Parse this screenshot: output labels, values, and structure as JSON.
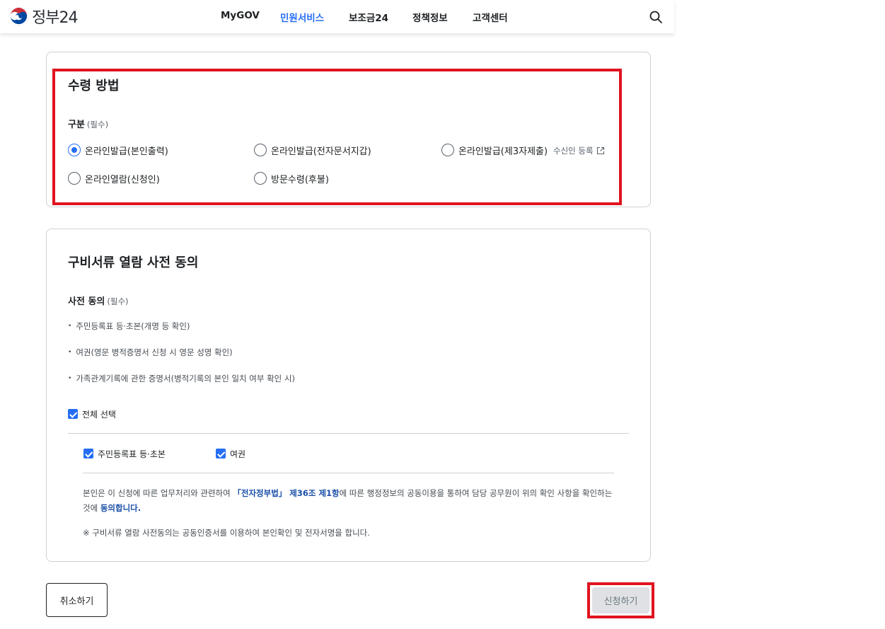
{
  "header": {
    "logo_text": "정부24",
    "nav": [
      "MyGOV",
      "민원서비스",
      "보조금24",
      "정책정보",
      "고객센터"
    ],
    "active_nav": "민원서비스",
    "search_icon": "search-icon"
  },
  "receipt": {
    "title": "수령 방법",
    "field_label": "구분",
    "required": "(필수)",
    "options": [
      {
        "label": "온라인발급(본인출력)",
        "checked": true
      },
      {
        "label": "온라인발급(전자문서지갑)",
        "checked": false
      },
      {
        "label": "온라인발급(제3자제출)",
        "checked": false
      },
      {
        "label": "온라인열람(신청인)",
        "checked": false
      },
      {
        "label": "방문수령(후불)",
        "checked": false
      }
    ],
    "receiver_link": "수신인 등록"
  },
  "consent": {
    "title": "구비서류 열람 사전 동의",
    "field_label": "사전 동의",
    "required": "(필수)",
    "items": [
      "주민등록표 등·초본(개명 등 확인)",
      "여권(영문 병적증명서 신청 시 영문 성명 확인)",
      "가족관계기록에 관한 증명서(병적기록의 본인 일치 여부 확인 시)"
    ],
    "select_all": {
      "label": "전체 선택",
      "checked": true
    },
    "checks": [
      {
        "label": "주민등록표 등·초본",
        "checked": true
      },
      {
        "label": "여권",
        "checked": true
      }
    ],
    "statement": {
      "pre": "본인은 이 신청에 따른 업무처리와 관련하여 ",
      "law": "「전자정부법」 제36조 제1항",
      "mid": "에 따른 행정정보의 공동이용을 통하여 담당 공무원이 위의 확인 사항을 확인하는 것에 ",
      "agree": "동의합니다."
    },
    "note": "※ 구비서류 열람 사전동의는 공동인증서를 이용하여 본인확인 및 전자서명을 합니다."
  },
  "actions": {
    "cancel": "취소하기",
    "apply": "신청하기"
  },
  "colors": {
    "accent": "#256ef4",
    "highlight": "#e0141f",
    "link_dark": "#1a4ea8"
  }
}
